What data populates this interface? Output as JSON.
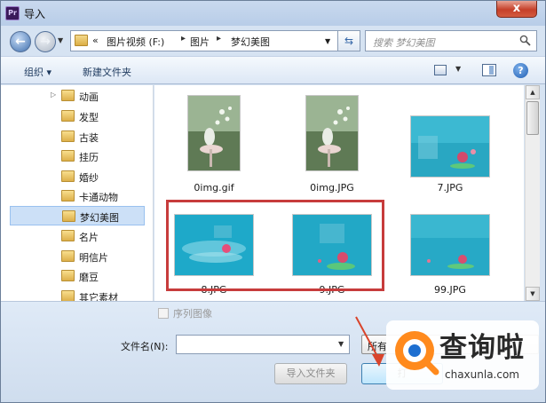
{
  "window": {
    "title": "导入",
    "app_icon_text": "Pr",
    "close_label": "x"
  },
  "navigation": {
    "breadcrumb_prefix": "«",
    "breadcrumb": [
      "图片视频 (F:)",
      "图片",
      "梦幻美图"
    ],
    "breadcrumb_separator": "▸",
    "search_placeholder": "搜索 梦幻美图"
  },
  "toolbar": {
    "organize_label": "组织 ▾",
    "new_folder_label": "新建文件夹",
    "help_label": "?"
  },
  "sidebar": {
    "items": [
      {
        "label": "动画",
        "expander": "▷",
        "selected": false
      },
      {
        "label": "发型",
        "expander": "",
        "selected": false
      },
      {
        "label": "古装",
        "expander": "",
        "selected": false
      },
      {
        "label": "挂历",
        "expander": "",
        "selected": false
      },
      {
        "label": "婚纱",
        "expander": "",
        "selected": false
      },
      {
        "label": "卡通动物",
        "expander": "",
        "selected": false
      },
      {
        "label": "梦幻美图",
        "expander": "",
        "selected": true
      },
      {
        "label": "名片",
        "expander": "",
        "selected": false
      },
      {
        "label": "明信片",
        "expander": "",
        "selected": false
      },
      {
        "label": "磨豆",
        "expander": "",
        "selected": false
      },
      {
        "label": "其它素材",
        "expander": "",
        "selected": false
      }
    ]
  },
  "files": [
    {
      "name": "0img.gif",
      "style": "portrait"
    },
    {
      "name": "0img.JPG",
      "style": "portrait"
    },
    {
      "name": "7.JPG",
      "style": "teal"
    },
    {
      "name": "8.JPG",
      "style": "teal"
    },
    {
      "name": "9.JPG",
      "style": "teal"
    },
    {
      "name": "99.JPG",
      "style": "teal"
    }
  ],
  "bottom": {
    "sequence_label": "序列图像",
    "filename_label": "文件名(N):",
    "filename_value": "",
    "filetype_value": "所有",
    "import_folder_label": "导入文件夹",
    "open_label": "打"
  },
  "watermark": {
    "title": "查询啦",
    "url": "chaxunla.com"
  },
  "colors": {
    "highlight": "#c73c3c",
    "accent_blue": "#3e6fae",
    "selection": "#cce0f7"
  }
}
